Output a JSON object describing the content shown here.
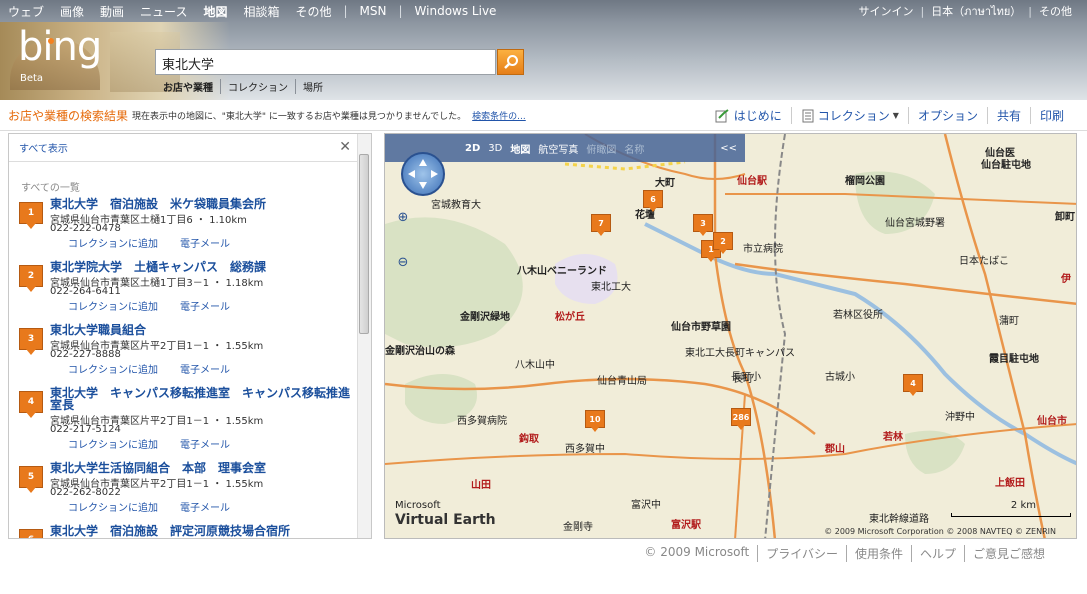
{
  "nav": {
    "links": [
      "ウェブ",
      "画像",
      "動画",
      "ニュース",
      "地図",
      "相談箱",
      "その他"
    ],
    "active": "地図",
    "ext": [
      "MSN",
      "Windows Live"
    ],
    "signin": "サインイン",
    "region": "日本（ภาษาไทย）",
    "more": "その他"
  },
  "brand": {
    "logo": "bing",
    "beta": "Beta"
  },
  "search": {
    "value": "東北大学",
    "scopes": [
      "お店や業種",
      "コレクション",
      "場所"
    ]
  },
  "results": {
    "title": "お店や業種の検索結果",
    "message": "現在表示中の地図に、\"東北大学\" に一致するお店や業種は見つかりませんでした。",
    "link": "検索条件の..."
  },
  "tools": [
    "はじめに",
    "コレクション",
    "オプション",
    "共有",
    "印刷"
  ],
  "panel": {
    "show_all": "すべて表示",
    "list_heading": "すべての一覧",
    "add_collection": "コレクションに追加",
    "email": "電子メール",
    "items": [
      {
        "num": "1",
        "title": "東北大学　宿泊施設　米ケ袋職員集会所",
        "address": "宮城県仙台市青葉区土樋1丁目6 ・ 1.10km",
        "phone": "022-222-0478"
      },
      {
        "num": "2",
        "title": "東北学院大学　土樋キャンパス　総務課",
        "address": "宮城県仙台市青葉区土樋1丁目3－1 ・ 1.18km",
        "phone": "022-264-6411"
      },
      {
        "num": "3",
        "title": "東北大学職員組合",
        "address": "宮城県仙台市青葉区片平2丁目1－1 ・ 1.55km",
        "phone": "022-227-8888"
      },
      {
        "num": "4",
        "title": "東北大学　キャンパス移転推進室　キャンパス移転推進室長",
        "address": "宮城県仙台市青葉区片平2丁目1－1 ・ 1.55km",
        "phone": "022-217-5124"
      },
      {
        "num": "5",
        "title": "東北大学生活協同組合　本部　理事会室",
        "address": "宮城県仙台市青葉区片平2丁目1－1 ・ 1.55km",
        "phone": "022-262-8022"
      },
      {
        "num": "6",
        "title": "東北大学　宿泊施設　評定河原競技場合宿所",
        "address": "",
        "phone": ""
      }
    ]
  },
  "map": {
    "toolbar": [
      "2D",
      "3D",
      "地図",
      "航空写真",
      "俯瞰図",
      "名称",
      "<<"
    ],
    "labels": [
      "仙台駅",
      "榴岡公園",
      "仙台医",
      "仙台駐屯地",
      "大町",
      "花壇",
      "宮城教育大",
      "仙台宮城野署",
      "卸町",
      "市立病院",
      "日本たばこ",
      "八木山ベニーランド",
      "東北工大",
      "若林区役所",
      "金剛沢緑地",
      "松が丘",
      "仙台市野草園",
      "東北工大長町キャンパス",
      "蒲町",
      "伊",
      "霞目駐屯地",
      "金剛沢治山の森",
      "八木山中",
      "仙台青山局",
      "長町小",
      "古城小",
      "西多賀病院",
      "鈎取",
      "西多賀中",
      "長町",
      "若林",
      "沖野中",
      "仙台市",
      "郡山",
      "上飯田",
      "山田",
      "富沢駅",
      "富沢中",
      "金剛寺",
      "東北幹線道路",
      "Microsoft",
      "Virtual Earth",
      "2 km",
      "4",
      "286"
    ],
    "pins": [
      "1",
      "2",
      "3",
      "6",
      "7",
      "10"
    ],
    "scale": "2 km",
    "copyright": "© 2009 Microsoft Corporation  © 2008 NAVTEQ  © ZENRIN"
  },
  "footer": [
    "© 2009 Microsoft",
    "プライバシー",
    "使用条件",
    "ヘルプ",
    "ご意見ご感想"
  ]
}
